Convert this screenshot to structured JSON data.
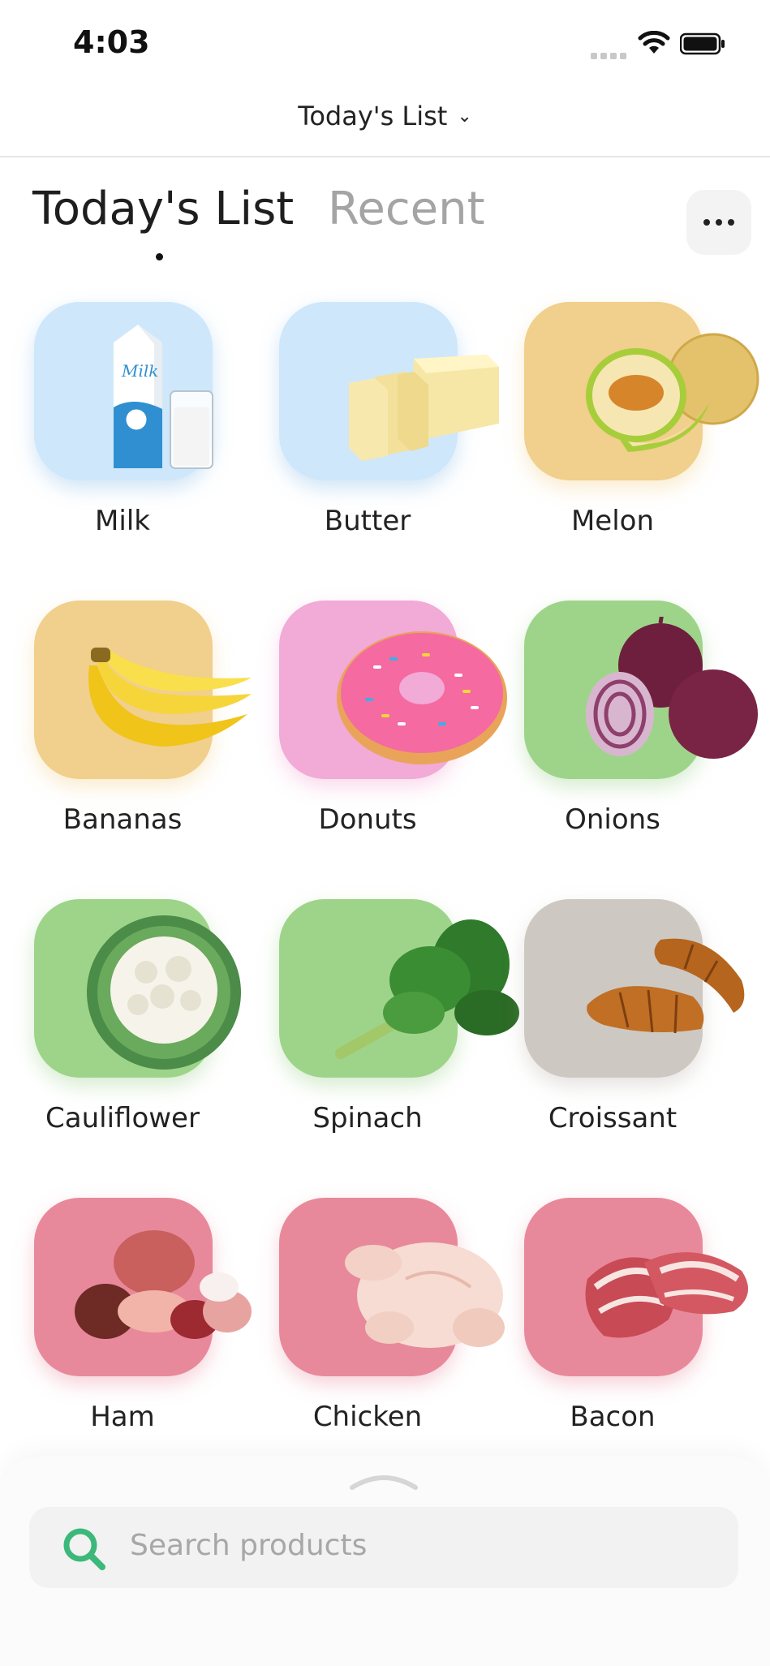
{
  "status_bar": {
    "time": "4:03"
  },
  "navbar": {
    "title": "Today's List"
  },
  "tabs": [
    {
      "label": "Today's List",
      "active": true
    },
    {
      "label": "Recent",
      "active": false
    }
  ],
  "colors": {
    "blue_tile": "#cfe7fa",
    "yellow_tile": "#f1cf8c",
    "pink_tile": "#f2aad6",
    "green_tile": "#9ed48a",
    "gray_tile": "#cdc9c2",
    "red_tile": "#e8899b",
    "search_icon": "#3cb87a"
  },
  "products": [
    {
      "name": "Milk",
      "icon": "milk-carton",
      "tile": "#cfe7fa"
    },
    {
      "name": "Butter",
      "icon": "butter-block",
      "tile": "#cfe7fa"
    },
    {
      "name": "Melon",
      "icon": "melon",
      "tile": "#f1cf8c"
    },
    {
      "name": "Bananas",
      "icon": "banana-bunch",
      "tile": "#f1cf8c"
    },
    {
      "name": "Donuts",
      "icon": "donut",
      "tile": "#f2aad6"
    },
    {
      "name": "Onions",
      "icon": "red-onion",
      "tile": "#9ed48a"
    },
    {
      "name": "Cauliflower",
      "icon": "cauliflower",
      "tile": "#9ed48a"
    },
    {
      "name": "Spinach",
      "icon": "spinach",
      "tile": "#9ed48a"
    },
    {
      "name": "Croissant",
      "icon": "croissant",
      "tile": "#cdc9c2"
    },
    {
      "name": "Ham",
      "icon": "ham",
      "tile": "#e8899b"
    },
    {
      "name": "Chicken",
      "icon": "raw-chicken",
      "tile": "#e8899b"
    },
    {
      "name": "Bacon",
      "icon": "bacon",
      "tile": "#e8899b"
    }
  ],
  "search": {
    "placeholder": "Search products"
  }
}
